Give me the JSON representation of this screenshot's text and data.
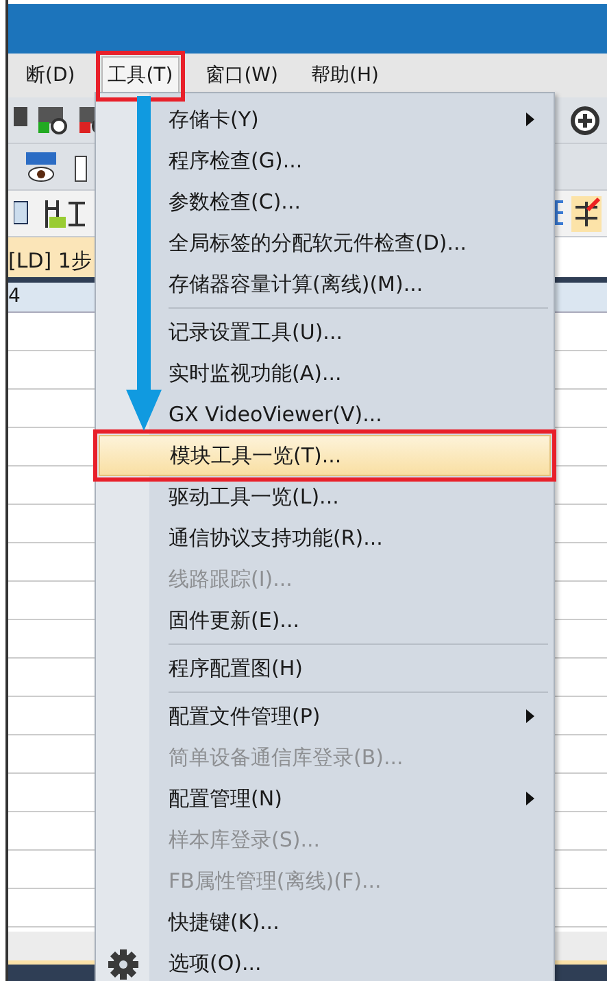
{
  "menubar": [
    {
      "label": "断(D)",
      "selected": false
    },
    {
      "label": "工具(T)",
      "selected": true
    },
    {
      "label": "窗口(W)",
      "selected": false
    },
    {
      "label": "帮助(H)",
      "selected": false
    }
  ],
  "editor_tab": {
    "label": "[LD] 1步"
  },
  "column_header": {
    "label": "4"
  },
  "menu": {
    "items": [
      {
        "kind": "item",
        "label": "存储卡(Y)",
        "disabled": false,
        "submenu": true,
        "selected": false
      },
      {
        "kind": "item",
        "label": "程序检查(G)...",
        "disabled": false,
        "submenu": false,
        "selected": false
      },
      {
        "kind": "item",
        "label": "参数检查(C)...",
        "disabled": false,
        "submenu": false,
        "selected": false
      },
      {
        "kind": "item",
        "label": "全局标签的分配软元件检查(D)...",
        "disabled": false,
        "submenu": false,
        "selected": false
      },
      {
        "kind": "item",
        "label": "存储器容量计算(离线)(M)...",
        "disabled": false,
        "submenu": false,
        "selected": false
      },
      {
        "kind": "separator"
      },
      {
        "kind": "item",
        "label": "记录设置工具(U)...",
        "disabled": false,
        "submenu": false,
        "selected": false
      },
      {
        "kind": "item",
        "label": "实时监视功能(A)...",
        "disabled": false,
        "submenu": false,
        "selected": false
      },
      {
        "kind": "item",
        "label": "GX VideoViewer(V)...",
        "disabled": false,
        "submenu": false,
        "selected": false
      },
      {
        "kind": "item",
        "label": "模块工具一览(T)...",
        "disabled": false,
        "submenu": false,
        "selected": true
      },
      {
        "kind": "item",
        "label": "驱动工具一览(L)...",
        "disabled": false,
        "submenu": false,
        "selected": false
      },
      {
        "kind": "item",
        "label": "通信协议支持功能(R)...",
        "disabled": false,
        "submenu": false,
        "selected": false
      },
      {
        "kind": "item",
        "label": "线路跟踪(I)...",
        "disabled": true,
        "submenu": false,
        "selected": false
      },
      {
        "kind": "item",
        "label": "固件更新(E)...",
        "disabled": false,
        "submenu": false,
        "selected": false
      },
      {
        "kind": "separator"
      },
      {
        "kind": "item",
        "label": "程序配置图(H)",
        "disabled": false,
        "submenu": false,
        "selected": false
      },
      {
        "kind": "separator"
      },
      {
        "kind": "item",
        "label": "配置文件管理(P)",
        "disabled": false,
        "submenu": true,
        "selected": false
      },
      {
        "kind": "item",
        "label": "简单设备通信库登录(B)...",
        "disabled": true,
        "submenu": false,
        "selected": false
      },
      {
        "kind": "item",
        "label": "配置管理(N)",
        "disabled": false,
        "submenu": true,
        "selected": false
      },
      {
        "kind": "item",
        "label": "样本库登录(S)...",
        "disabled": true,
        "submenu": false,
        "selected": false
      },
      {
        "kind": "item",
        "label": "FB属性管理(离线)(F)...",
        "disabled": true,
        "submenu": false,
        "selected": false
      },
      {
        "kind": "item",
        "label": "快捷键(K)...",
        "disabled": false,
        "submenu": false,
        "selected": false
      },
      {
        "kind": "item",
        "label": "选项(O)...",
        "disabled": false,
        "submenu": false,
        "selected": false,
        "icon": true
      }
    ]
  }
}
